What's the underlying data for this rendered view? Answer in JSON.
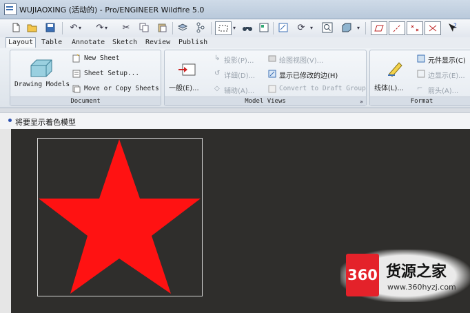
{
  "window": {
    "title": "WUJIAOXING (活动的) - Pro/ENGINEER Wildfire 5.0"
  },
  "tabs": [
    "Layout",
    "Table",
    "Annotate",
    "Sketch",
    "Review",
    "Publish"
  ],
  "active_tab": "Layout",
  "ribbon": {
    "document": {
      "label": "Document",
      "drawing_models": "Drawing Models",
      "new_sheet": "New Sheet",
      "sheet_setup": "Sheet Setup...",
      "move_copy": "Move or Copy Sheets"
    },
    "model_views": {
      "label": "Model Views",
      "general": "一般(E)...",
      "projection": "投影(P)...",
      "detailed": "详细(D)...",
      "auxiliary": "辅助(A)...",
      "drawing_view": "绘图视图(V)...",
      "show_modified_edges": "显示已修改的边(H)",
      "convert": "Convert to Draft Group"
    },
    "format": {
      "label": "Format",
      "line_style": "线体(L)...",
      "element_display": "元件显示(C)",
      "edge_display": "边显示(E)...",
      "arrow": "箭头(A)..."
    }
  },
  "status": {
    "text": "将要显示着色模型"
  },
  "canvas": {
    "background": "#2f2e2c",
    "shape_color": "#ff1212",
    "shape": "five-pointed star"
  },
  "watermark": {
    "logo": "360",
    "name": "货源之家",
    "url": "www.360hyzj.com"
  },
  "colors": {
    "accent": "#e4222a",
    "ribbon": "#dde3ea"
  }
}
